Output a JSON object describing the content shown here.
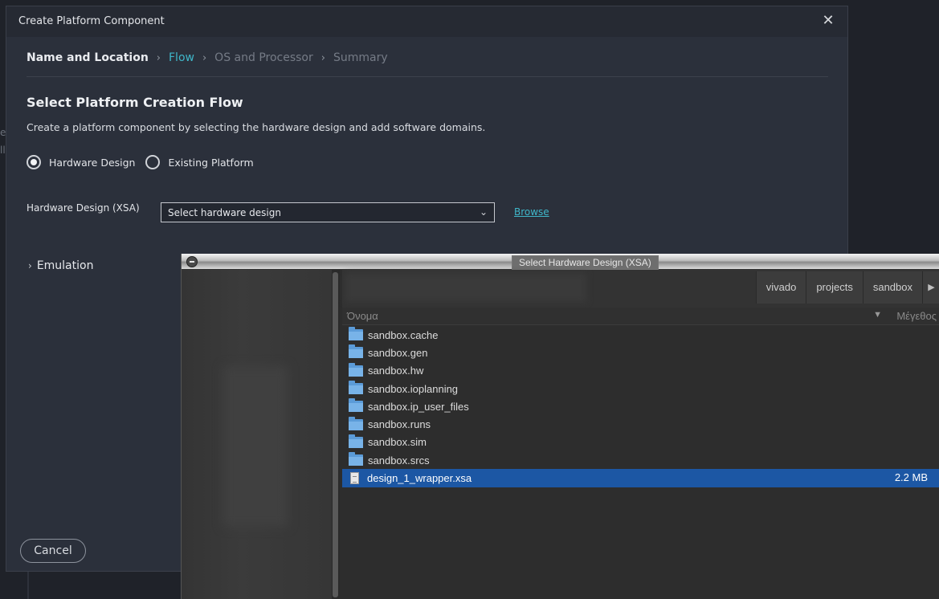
{
  "background": {
    "fragments": [
      "e",
      "ll"
    ]
  },
  "dialog": {
    "title": "Create Platform Component",
    "breadcrumb": [
      "Name and Location",
      "Flow",
      "OS and Processor",
      "Summary"
    ],
    "section_title": "Select Platform Creation Flow",
    "description": "Create a platform component by selecting the hardware design and add software domains.",
    "radios": [
      {
        "label": "Hardware Design",
        "checked": true
      },
      {
        "label": "Existing Platform",
        "checked": false
      }
    ],
    "xsa_label": "Hardware Design (XSA)",
    "xsa_select_value": "Select hardware design",
    "browse_label": "Browse",
    "emulation_label": "Emulation",
    "cancel_label": "Cancel",
    "accent_color": "#3fb6c9"
  },
  "chooser": {
    "title": "Select Hardware Design (XSA)",
    "path": [
      "vivado",
      "projects",
      "sandbox"
    ],
    "columns": {
      "name": "Όνομα",
      "size": "Μέγεθος"
    },
    "rows": [
      {
        "name": "sandbox.cache",
        "type": "folder",
        "size": ""
      },
      {
        "name": "sandbox.gen",
        "type": "folder",
        "size": ""
      },
      {
        "name": "sandbox.hw",
        "type": "folder",
        "size": ""
      },
      {
        "name": "sandbox.ioplanning",
        "type": "folder",
        "size": ""
      },
      {
        "name": "sandbox.ip_user_files",
        "type": "folder",
        "size": ""
      },
      {
        "name": "sandbox.runs",
        "type": "folder",
        "size": ""
      },
      {
        "name": "sandbox.sim",
        "type": "folder",
        "size": ""
      },
      {
        "name": "sandbox.srcs",
        "type": "folder",
        "size": ""
      },
      {
        "name": "design_1_wrapper.xsa",
        "type": "file",
        "size": "2.2 MB",
        "selected": true
      }
    ],
    "selection_color": "#1c57a4"
  }
}
